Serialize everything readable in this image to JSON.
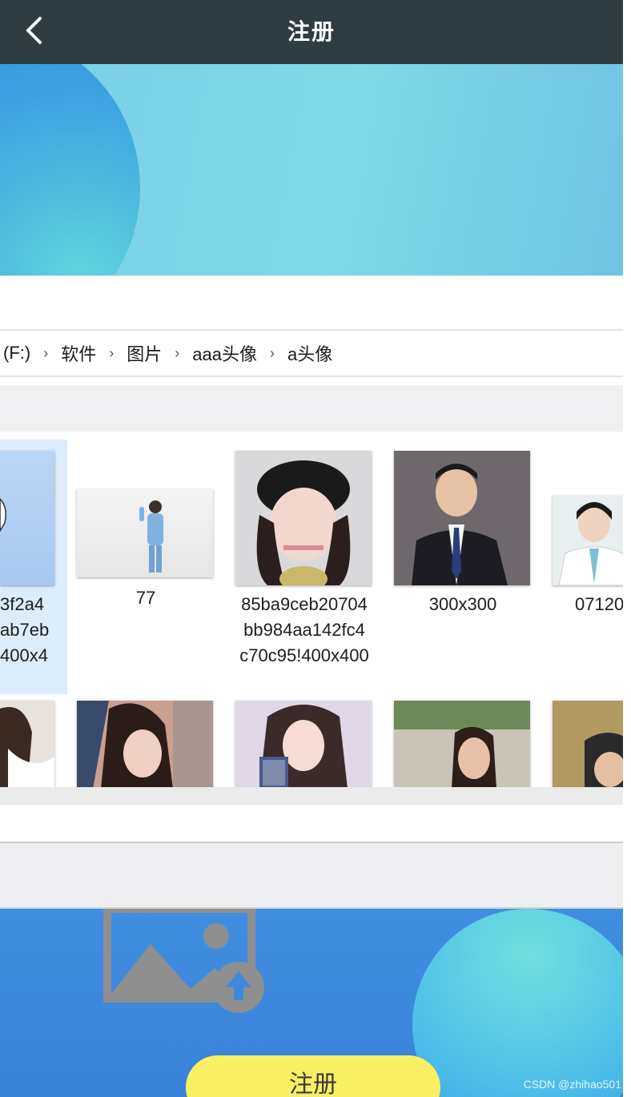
{
  "header": {
    "title": "注册"
  },
  "file_dialog": {
    "breadcrumb": [
      {
        "label": "(F:)"
      },
      {
        "label": "软件"
      },
      {
        "label": "图片"
      },
      {
        "label": "aaa头像"
      },
      {
        "label": "a头像"
      }
    ],
    "row1": [
      {
        "label": "3f2a4\nab7eb\n400x4",
        "selected": true
      },
      {
        "label": "77"
      },
      {
        "label": "85ba9ceb20704\nbb984aa142fc4\nc70c95!400x400"
      },
      {
        "label": "300x300"
      },
      {
        "label": "07120"
      }
    ]
  },
  "form": {
    "register_label": "注册"
  },
  "watermark": "CSDN @zhihao501",
  "colors": {
    "header_bg": "#2f3c42",
    "banner_light": "#7fd9e8",
    "banner_dark": "#3a82da",
    "button_yellow": "#f9ef63"
  },
  "icons": {
    "back": "chevron-left-icon",
    "upload": "image-upload-icon",
    "crumb_separator": "chevron-right-icon"
  }
}
